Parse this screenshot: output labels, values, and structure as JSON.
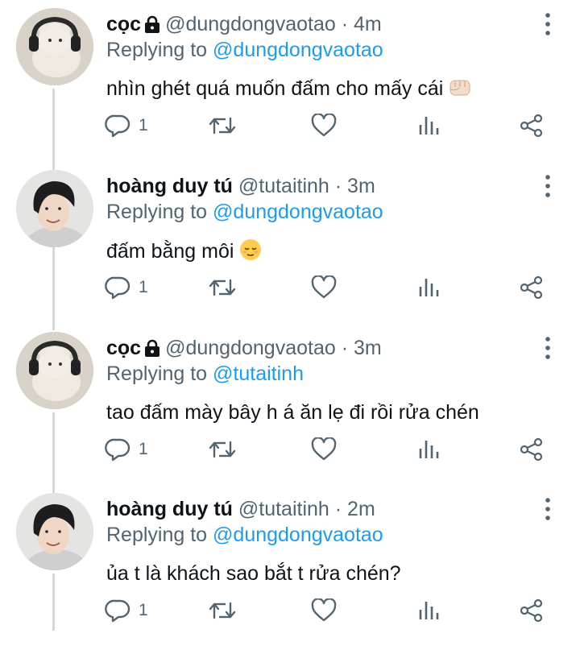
{
  "replying_prefix": "Replying to",
  "colors": {
    "text": "#0f1419",
    "secondary": "#536471",
    "accent": "#1d9bf0",
    "thread_line": "#cfd9de"
  },
  "tweets": [
    {
      "name": "cọc",
      "locked": true,
      "handle": "@dungdongvaotao",
      "time": "4m",
      "reply_to": "@dungdongvaotao",
      "text": "nhìn ghét quá muốn đấm cho mấy cái",
      "emoji": "fist-emoji",
      "reply_count": "1",
      "avatar": "plush-bear-avatar"
    },
    {
      "name": "hoàng duy tú",
      "locked": false,
      "handle": "@tutaitinh",
      "time": "3m",
      "reply_to": "@dungdongvaotao",
      "text": "đấm bằng môi",
      "emoji": "relieved-face-emoji",
      "reply_count": "1",
      "avatar": "person-avatar"
    },
    {
      "name": "cọc",
      "locked": true,
      "handle": "@dungdongvaotao",
      "time": "3m",
      "reply_to": "@tutaitinh",
      "text": "tao đấm mày bây h á ăn lẹ đi rồi rửa chén",
      "emoji": "",
      "reply_count": "1",
      "avatar": "plush-bear-avatar"
    },
    {
      "name": "hoàng duy tú",
      "locked": false,
      "handle": "@tutaitinh",
      "time": "2m",
      "reply_to": "@dungdongvaotao",
      "text": "ủa t là khách sao bắt t rửa chén?",
      "emoji": "",
      "reply_count": "1",
      "avatar": "person-avatar"
    }
  ]
}
